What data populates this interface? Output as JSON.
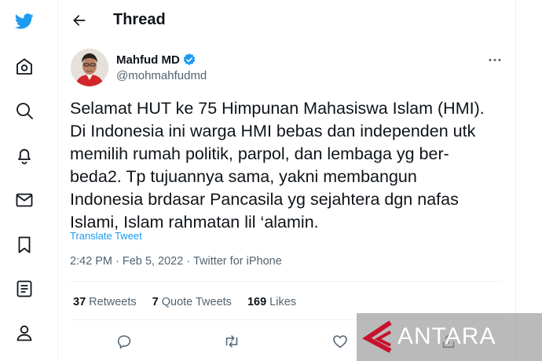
{
  "sidebar": {
    "icons": [
      "twitter-logo",
      "home-icon",
      "explore-icon",
      "notifications-icon",
      "messages-icon",
      "bookmarks-icon",
      "lists-icon",
      "profile-icon"
    ],
    "brand_color": "#1d9bf0"
  },
  "header": {
    "title": "Thread"
  },
  "tweet": {
    "author_name": "Mahfud MD",
    "author_handle": "@mohmahfudmd",
    "verified": true,
    "text_lines": [
      "Selamat HUT ke 75 Himpunan Mahasiswa Islam (HMI).",
      "Di Indonesia ini warga HMI bebas dan independen utk",
      "memilih rumah politik, parpol, dan lembaga yg ber-",
      "beda2. Tp tujuannya sama, yakni membangun",
      "Indonesia brdasar Pancasila yg sejahtera dgn nafas",
      "Islami, Islam rahmatan lil ‘alamin."
    ],
    "translate_label": "Translate Tweet",
    "time": "2:42 PM",
    "date": "Feb 5, 2022",
    "source": "Twitter for iPhone",
    "separator": "·"
  },
  "stats": {
    "retweets_count": "37",
    "retweets_label": "Retweets",
    "quotes_count": "7",
    "quotes_label": "Quote Tweets",
    "likes_count": "169",
    "likes_label": "Likes"
  },
  "actions": [
    "reply-icon",
    "retweet-icon",
    "like-icon",
    "share-icon"
  ],
  "watermark": {
    "text": "ANTARA",
    "accent_color": "#c8102e"
  }
}
